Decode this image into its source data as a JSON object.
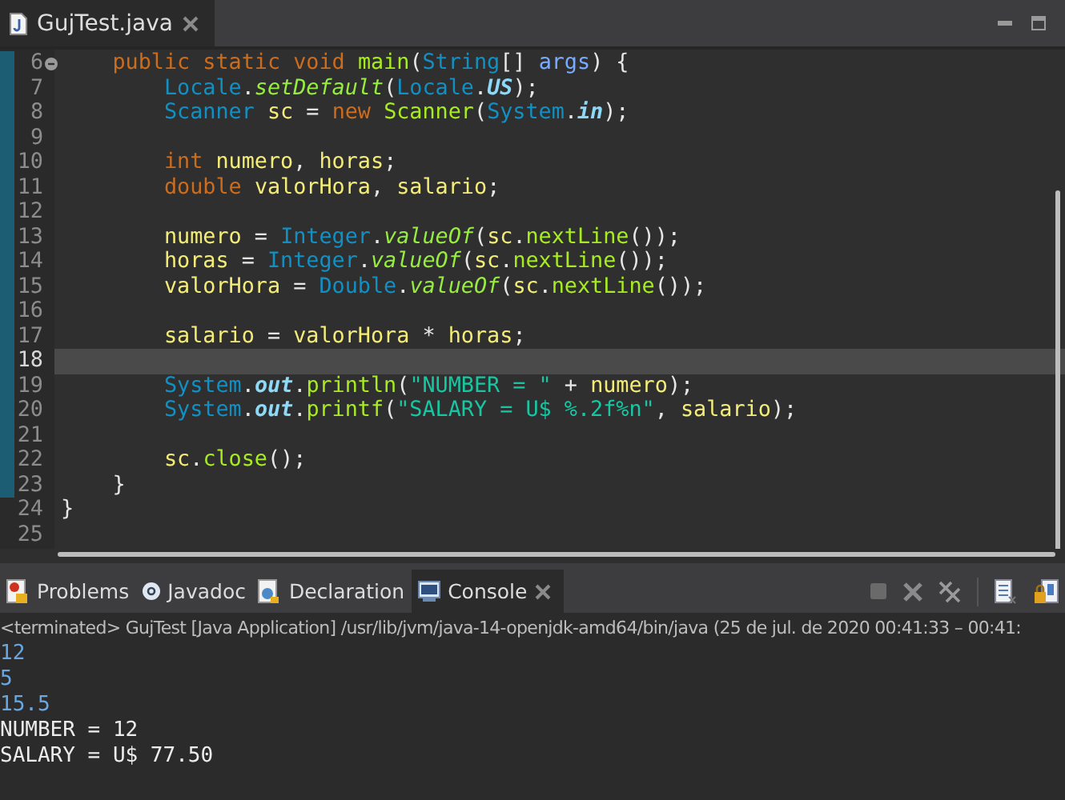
{
  "editor_tab": {
    "label": "GujTest.java",
    "selected": true
  },
  "code": [
    {
      "number": "6",
      "fold": true,
      "current": false,
      "tokens": [
        {
          "kind": "kw",
          "t": "    public static void "
        },
        {
          "kind": "method",
          "t": "main"
        },
        {
          "kind": "plain",
          "t": "("
        },
        {
          "kind": "type",
          "t": "String"
        },
        {
          "kind": "plain",
          "t": "[] "
        },
        {
          "kind": "param",
          "t": "args"
        },
        {
          "kind": "plain",
          "t": ") {"
        }
      ]
    },
    {
      "number": "7",
      "fold": false,
      "current": false,
      "tokens": [
        {
          "kind": "type",
          "t": "        Locale"
        },
        {
          "kind": "plain",
          "t": "."
        },
        {
          "kind": "static_method",
          "t": "setDefault"
        },
        {
          "kind": "plain",
          "t": "("
        },
        {
          "kind": "type",
          "t": "Locale"
        },
        {
          "kind": "plain",
          "t": "."
        },
        {
          "kind": "static_field",
          "t": "US"
        },
        {
          "kind": "plain",
          "t": ");"
        }
      ]
    },
    {
      "number": "8",
      "fold": false,
      "current": false,
      "tokens": [
        {
          "kind": "type",
          "t": "        Scanner "
        },
        {
          "kind": "local",
          "t": "sc"
        },
        {
          "kind": "plain",
          "t": " = "
        },
        {
          "kind": "kw",
          "t": "new "
        },
        {
          "kind": "method",
          "t": "Scanner"
        },
        {
          "kind": "plain",
          "t": "("
        },
        {
          "kind": "type",
          "t": "System"
        },
        {
          "kind": "plain",
          "t": "."
        },
        {
          "kind": "static_field",
          "t": "in"
        },
        {
          "kind": "plain",
          "t": ");"
        }
      ]
    },
    {
      "number": "9",
      "fold": false,
      "current": false
    },
    {
      "number": "10",
      "fold": false,
      "current": false,
      "tokens": [
        {
          "kind": "kw",
          "t": "        int "
        },
        {
          "kind": "local",
          "t": "numero"
        },
        {
          "kind": "plain",
          "t": ", "
        },
        {
          "kind": "local",
          "t": "horas"
        },
        {
          "kind": "plain",
          "t": ";"
        }
      ]
    },
    {
      "number": "11",
      "fold": false,
      "current": false,
      "tokens": [
        {
          "kind": "kw",
          "t": "        double "
        },
        {
          "kind": "local",
          "t": "valorHora"
        },
        {
          "kind": "plain",
          "t": ", "
        },
        {
          "kind": "local",
          "t": "salario"
        },
        {
          "kind": "plain",
          "t": ";"
        }
      ]
    },
    {
      "number": "12",
      "fold": false,
      "current": false
    },
    {
      "number": "13",
      "fold": false,
      "current": false,
      "tokens": [
        {
          "kind": "local",
          "t": "        numero"
        },
        {
          "kind": "plain",
          "t": " = "
        },
        {
          "kind": "type",
          "t": "Integer"
        },
        {
          "kind": "plain",
          "t": "."
        },
        {
          "kind": "static_method",
          "t": "valueOf"
        },
        {
          "kind": "plain",
          "t": "("
        },
        {
          "kind": "local",
          "t": "sc"
        },
        {
          "kind": "plain",
          "t": "."
        },
        {
          "kind": "method",
          "t": "nextLine"
        },
        {
          "kind": "plain",
          "t": "());"
        }
      ]
    },
    {
      "number": "14",
      "fold": false,
      "current": false,
      "tokens": [
        {
          "kind": "local",
          "t": "        horas"
        },
        {
          "kind": "plain",
          "t": " = "
        },
        {
          "kind": "type",
          "t": "Integer"
        },
        {
          "kind": "plain",
          "t": "."
        },
        {
          "kind": "static_method",
          "t": "valueOf"
        },
        {
          "kind": "plain",
          "t": "("
        },
        {
          "kind": "local",
          "t": "sc"
        },
        {
          "kind": "plain",
          "t": "."
        },
        {
          "kind": "method",
          "t": "nextLine"
        },
        {
          "kind": "plain",
          "t": "());"
        }
      ]
    },
    {
      "number": "15",
      "fold": false,
      "current": false,
      "tokens": [
        {
          "kind": "local",
          "t": "        valorHora"
        },
        {
          "kind": "plain",
          "t": " = "
        },
        {
          "kind": "type",
          "t": "Double"
        },
        {
          "kind": "plain",
          "t": "."
        },
        {
          "kind": "static_method",
          "t": "valueOf"
        },
        {
          "kind": "plain",
          "t": "("
        },
        {
          "kind": "local",
          "t": "sc"
        },
        {
          "kind": "plain",
          "t": "."
        },
        {
          "kind": "method",
          "t": "nextLine"
        },
        {
          "kind": "plain",
          "t": "());"
        }
      ]
    },
    {
      "number": "16",
      "fold": false,
      "current": false
    },
    {
      "number": "17",
      "fold": false,
      "current": false,
      "tokens": [
        {
          "kind": "local",
          "t": "        salario"
        },
        {
          "kind": "plain",
          "t": " = "
        },
        {
          "kind": "local",
          "t": "valorHora"
        },
        {
          "kind": "plain",
          "t": " * "
        },
        {
          "kind": "local",
          "t": "horas"
        },
        {
          "kind": "plain",
          "t": ";"
        }
      ]
    },
    {
      "number": "18",
      "fold": false,
      "current": true
    },
    {
      "number": "19",
      "fold": false,
      "current": false,
      "tokens": [
        {
          "kind": "type",
          "t": "        System"
        },
        {
          "kind": "plain",
          "t": "."
        },
        {
          "kind": "static_field",
          "t": "out"
        },
        {
          "kind": "plain",
          "t": "."
        },
        {
          "kind": "method",
          "t": "println"
        },
        {
          "kind": "plain",
          "t": "("
        },
        {
          "kind": "string",
          "t": "\"NUMBER = \""
        },
        {
          "kind": "plain",
          "t": " + "
        },
        {
          "kind": "local",
          "t": "numero"
        },
        {
          "kind": "plain",
          "t": ");"
        }
      ]
    },
    {
      "number": "20",
      "fold": false,
      "current": false,
      "tokens": [
        {
          "kind": "type",
          "t": "        System"
        },
        {
          "kind": "plain",
          "t": "."
        },
        {
          "kind": "static_field",
          "t": "out"
        },
        {
          "kind": "plain",
          "t": "."
        },
        {
          "kind": "method",
          "t": "printf"
        },
        {
          "kind": "plain",
          "t": "("
        },
        {
          "kind": "string",
          "t": "\"SALARY = U$ %.2f%n\""
        },
        {
          "kind": "plain",
          "t": ", "
        },
        {
          "kind": "local",
          "t": "salario"
        },
        {
          "kind": "plain",
          "t": ");"
        }
      ]
    },
    {
      "number": "21",
      "fold": false,
      "current": false
    },
    {
      "number": "22",
      "fold": false,
      "current": false,
      "tokens": [
        {
          "kind": "local",
          "t": "        sc"
        },
        {
          "kind": "plain",
          "t": "."
        },
        {
          "kind": "method",
          "t": "close"
        },
        {
          "kind": "plain",
          "t": "();"
        }
      ]
    },
    {
      "number": "23",
      "fold": false,
      "current": false,
      "tokens": [
        {
          "kind": "plain",
          "t": "    }"
        }
      ]
    },
    {
      "number": "24",
      "fold": false,
      "current": false,
      "tokens": [
        {
          "kind": "plain",
          "t": "}"
        }
      ]
    },
    {
      "number": "25",
      "fold": false,
      "current": false
    }
  ],
  "panel_tabs": [
    {
      "label": "Problems",
      "kind": "problems",
      "selected": false,
      "closable": false
    },
    {
      "label": "Javadoc",
      "kind": "javadoc",
      "selected": false,
      "closable": false
    },
    {
      "label": "Declaration",
      "kind": "declaration",
      "selected": false,
      "closable": false
    },
    {
      "label": "Console",
      "kind": "console",
      "selected": true,
      "closable": true
    }
  ],
  "console": {
    "header": "<terminated> GujTest [Java Application] /usr/lib/jvm/java-14-openjdk-amd64/bin/java  (25 de jul. de 2020 00:41:33 – 00:41:",
    "lines": [
      {
        "kind": "input",
        "text": "12"
      },
      {
        "kind": "input",
        "text": "5"
      },
      {
        "kind": "input",
        "text": "15.5"
      },
      {
        "kind": "output",
        "text": "NUMBER = 12"
      },
      {
        "kind": "output",
        "text": "SALARY = U$ 77.50"
      }
    ]
  }
}
